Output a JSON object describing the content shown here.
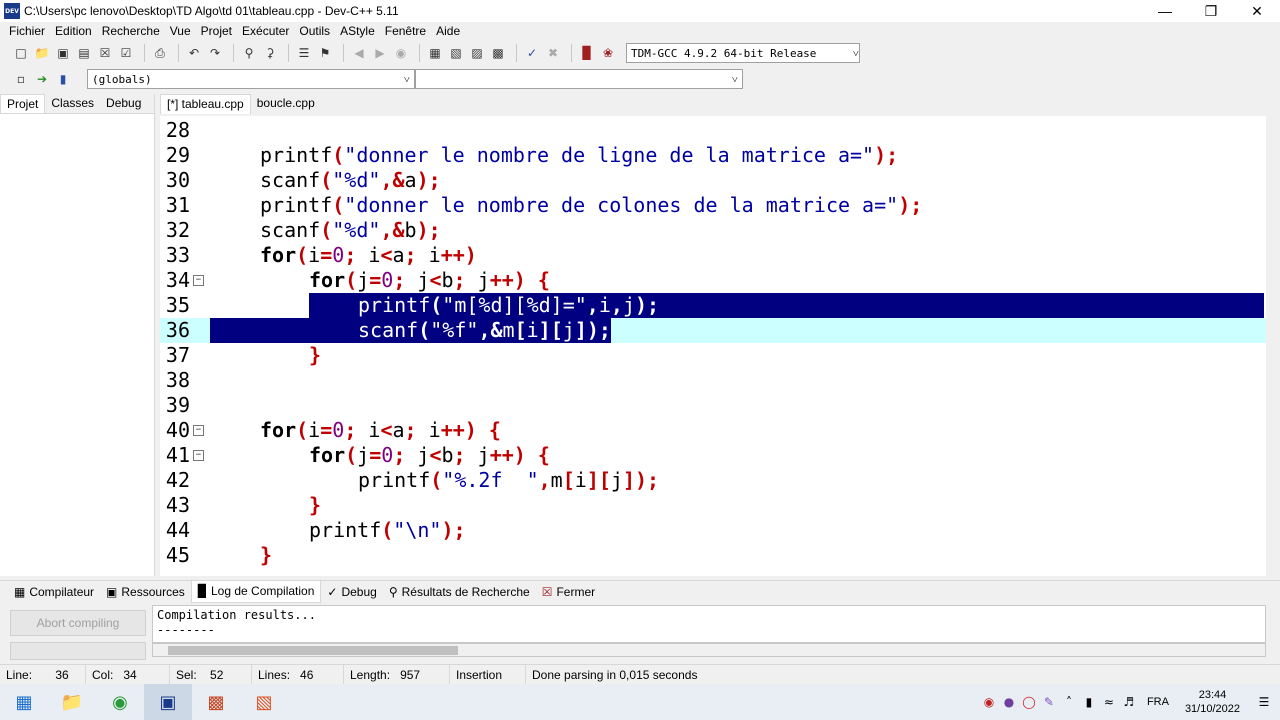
{
  "window": {
    "title": "C:\\Users\\pc lenovo\\Desktop\\TD Algo\\td 01\\tableau.cpp - Dev-C++ 5.11",
    "icon_label": "DEV"
  },
  "menu": [
    "Fichier",
    "Edition",
    "Recherche",
    "Vue",
    "Projet",
    "Exécuter",
    "Outils",
    "AStyle",
    "Fenêtre",
    "Aide"
  ],
  "toolbar": {
    "compiler": "TDM-GCC 4.9.2 64-bit Release",
    "scope": "(globals)",
    "function": ""
  },
  "left_tabs": [
    "Projet",
    "Classes",
    "Debug"
  ],
  "file_tabs": [
    "[*] tableau.cpp",
    "boucle.cpp"
  ],
  "editor": {
    "line_numbers": [
      "28",
      "29",
      "30",
      "31",
      "32",
      "33",
      "34",
      "35",
      "36",
      "37",
      "38",
      "39",
      "40",
      "41",
      "42",
      "43",
      "44",
      "45"
    ]
  },
  "bottom_tabs": [
    "Compilateur",
    "Ressources",
    "Log de Compilation",
    "Debug",
    "Résultats de Recherche",
    "Fermer"
  ],
  "abort_label": "Abort compiling",
  "log": {
    "line1": "Compilation results...",
    "line2": "--------"
  },
  "status": {
    "line": "Line:",
    "line_val": "36",
    "col": "Col:",
    "col_val": "34",
    "sel": "Sel:",
    "sel_val": "52",
    "lines": "Lines:",
    "lines_val": "46",
    "length": "Length:",
    "length_val": "957",
    "mode": "Insertion",
    "message": "Done parsing in 0,015 seconds"
  },
  "taskbar": {
    "lang": "FRA",
    "time": "23:44",
    "date": "31/10/2022"
  }
}
